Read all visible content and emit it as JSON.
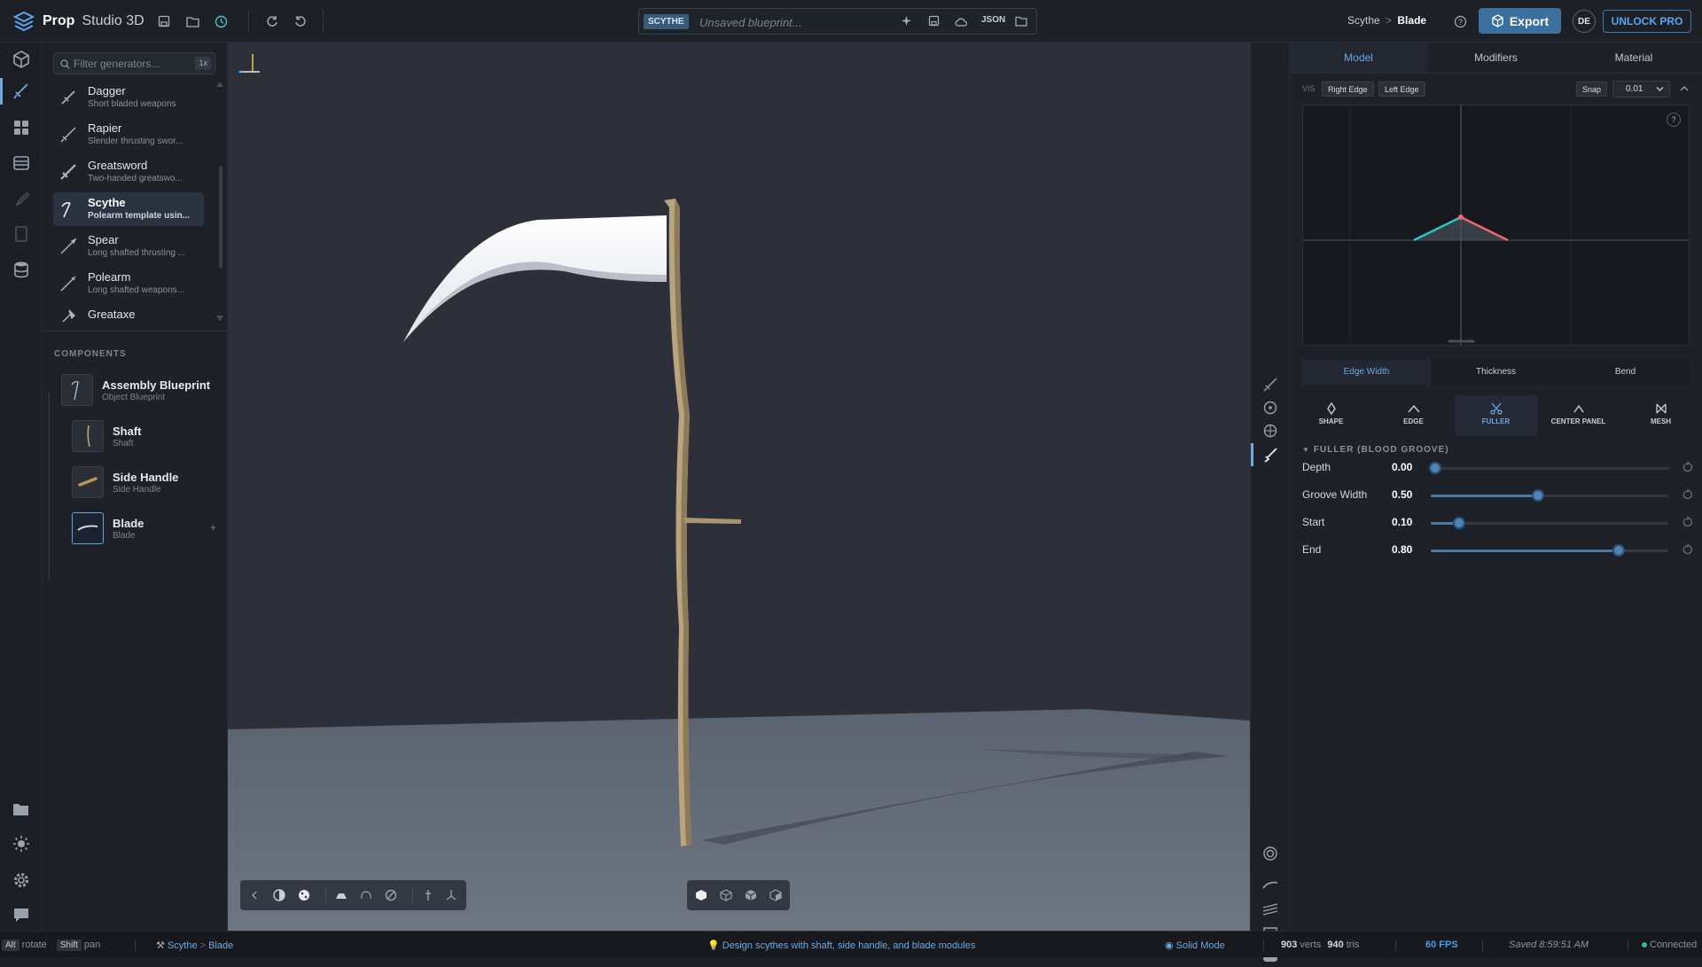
{
  "app": {
    "name_bold": "Prop",
    "name_rest": "Studio 3D"
  },
  "document": {
    "tag": "SCYTHE",
    "name": "Unsaved blueprint...",
    "json_label": "JSON"
  },
  "breadcrumb": {
    "item": "Scythe",
    "sep": ">",
    "current": "Blade"
  },
  "header": {
    "export_label": "Export",
    "avatar": "DE",
    "unlock_label": "UNLOCK PRO"
  },
  "generators": {
    "filter_placeholder": "Filter generators...",
    "filter_kbd": "1x",
    "items": [
      {
        "name": "Dagger",
        "desc": "Short bladed weapons"
      },
      {
        "name": "Rapier",
        "desc": "Slender thrusting swor..."
      },
      {
        "name": "Greatsword",
        "desc": "Two-handed greatswo..."
      },
      {
        "name": "Scythe",
        "desc": "Polearm template usin..."
      },
      {
        "name": "Spear",
        "desc": "Long shafted thrusting ..."
      },
      {
        "name": "Polearm",
        "desc": "Long shafted weapons..."
      },
      {
        "name": "Greataxe",
        "desc": ""
      }
    ]
  },
  "components": {
    "heading": "COMPONENTS",
    "items": [
      {
        "name": "Assembly Blueprint",
        "desc": "Object Blueprint"
      },
      {
        "name": "Shaft",
        "desc": "Shaft"
      },
      {
        "name": "Side Handle",
        "desc": "Side Handle"
      },
      {
        "name": "Blade",
        "desc": "Blade"
      }
    ]
  },
  "panel": {
    "tabs": [
      "Model",
      "Modifiers",
      "Material"
    ],
    "vis_label": "VIS",
    "edge_buttons": [
      "Right Edge",
      "Left Edge"
    ],
    "snap_label": "Snap",
    "snap_value": "0.01",
    "help": "?",
    "subtabs": [
      "Edge Width",
      "Thickness",
      "Bend"
    ],
    "modtabs": [
      "SHAPE",
      "EDGE",
      "FULLER",
      "CENTER PANEL",
      "MESH"
    ],
    "section_title": "FULLER (BLOOD GROOVE)",
    "params": [
      {
        "label": "Depth",
        "value": "0.00",
        "fraction": 0.02
      },
      {
        "label": "Groove Width",
        "value": "0.50",
        "fraction": 0.45
      },
      {
        "label": "Start",
        "value": "0.10",
        "fraction": 0.12
      },
      {
        "label": "End",
        "value": "0.80",
        "fraction": 0.79
      }
    ]
  },
  "status": {
    "alt": "Alt",
    "rotate": "rotate",
    "shift": "Shift",
    "pan": "pan",
    "crumb_item": "Scythe",
    "crumb_sep": ">",
    "crumb_current": "Blade",
    "hint": "Design scythes with shaft, side handle, and blade modules",
    "mode": "Solid Mode",
    "verts": "903",
    "verts_label": "verts",
    "tris": "940",
    "tris_label": "tris",
    "fps": "60 FPS",
    "saved": "Saved 8:59:51 AM",
    "connection": "Connected"
  },
  "colors": {
    "accent": "#6fa9df",
    "export": "#3b6f9e",
    "fps": "#4a9de8",
    "connected": "#2ec48a"
  }
}
